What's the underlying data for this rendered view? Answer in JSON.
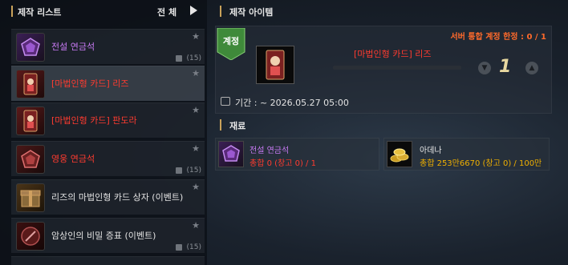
{
  "left_panel": {
    "title": "제작 리스트",
    "filter_label": "전 체",
    "items": [
      {
        "name": "전설 연금석",
        "count": "(15)",
        "color": "#c87af4"
      },
      {
        "name": "[마법인형 카드] 리즈",
        "count": "",
        "color": "#ff3b2f"
      },
      {
        "name": "[마법인형 카드] 판도라",
        "count": "",
        "color": "#ff3b2f"
      },
      {
        "name": "영웅 연금석",
        "count": "(15)",
        "color": "#ff3b2f"
      },
      {
        "name": "리즈의 마법인형 카드 상자 (이벤트)",
        "count": "",
        "color": "#e3e3e3"
      },
      {
        "name": "암상인의 비밀 증표 (이벤트)",
        "count": "(15)",
        "color": "#e3e3e3"
      }
    ]
  },
  "right_panel": {
    "title": "제작 아이템",
    "account_limit": "서버 통합 계정 한정 : 0 / 1",
    "badge_label": "계정",
    "item_name": "[마법인형 카드] 리즈",
    "quantity": "1",
    "period_label": "기간 : ~ 2026.05.27 05:00",
    "materials_title": "재료",
    "materials": [
      {
        "name": "전설 연금석",
        "detail": "총합 0 (창고 0) / 1",
        "name_color": "#c87af4",
        "detail_color": "#ff3b2f"
      },
      {
        "name": "아데나",
        "detail": "총합 253만6670 (창고 0) / 100만",
        "name_color": "#e3e3e3",
        "detail_color": "#f0b000"
      }
    ]
  }
}
